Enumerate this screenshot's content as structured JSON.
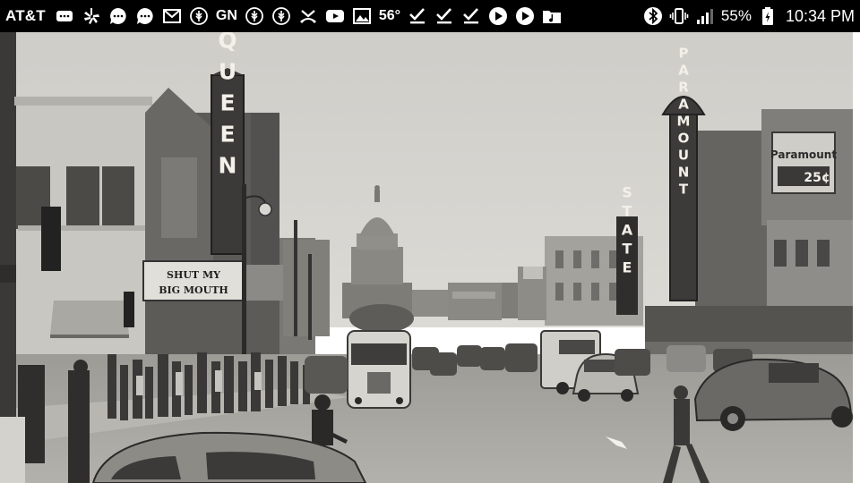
{
  "status_bar": {
    "carrier": "AT&T",
    "weather_temp": "56°",
    "news_label": "GN",
    "battery_percent": "55%",
    "time": "10:34 PM",
    "notification_icons": [
      "message-icon",
      "yelp-icon",
      "chat-icon",
      "chat-icon",
      "gmail-icon",
      "wheat-icon",
      "gn-text",
      "wheat-icon",
      "wheat-icon",
      "missed-call-icon",
      "youtube-icon",
      "image-icon",
      "temperature-text",
      "check-icon",
      "check-icon",
      "check-icon",
      "play-icon",
      "play-icon",
      "music-folder-icon"
    ],
    "system_icons": [
      "bluetooth-icon",
      "vibrate-icon",
      "signal-icon",
      "battery-icon"
    ]
  },
  "photo": {
    "style": "black-and-white historic street photograph",
    "signs": {
      "queen_vertical": "QUEEN",
      "queen_marquee_line1": "SHUT MY",
      "queen_marquee_line2": "BIG MOUTH",
      "paramount_vertical": "PARAMOUNT",
      "paramount_billboard_brand": "Paramount",
      "paramount_billboard_price": "25¢",
      "state_vertical": "STATE"
    }
  },
  "colors": {
    "status_bar_bg": "#000000",
    "status_bar_fg": "#ffffff",
    "sky": "#d4d2cd",
    "street": "#a7a59f"
  }
}
